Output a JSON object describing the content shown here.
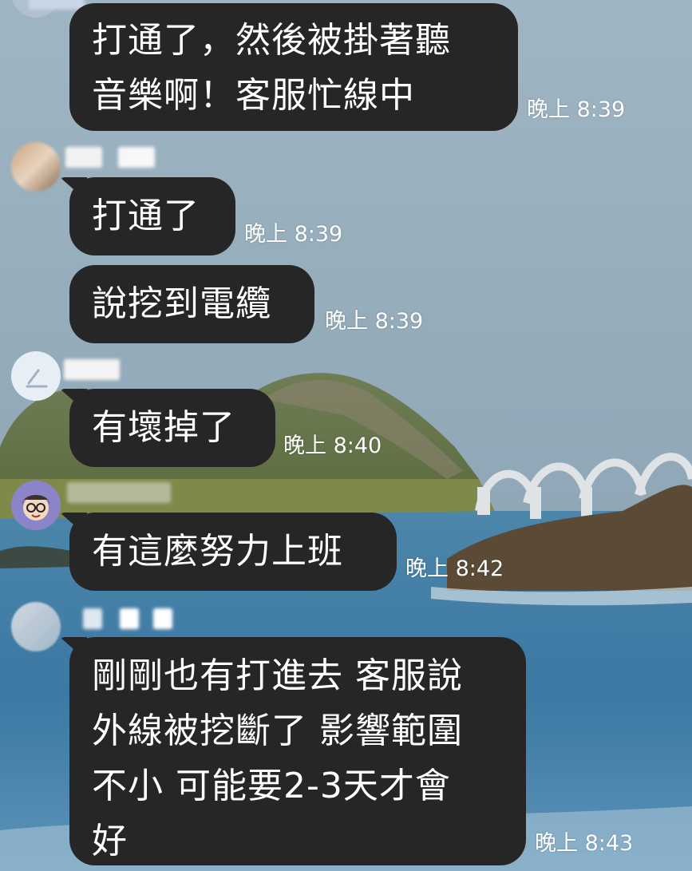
{
  "chat": {
    "messages": [
      {
        "text": "打通了，然後被掛著聽\n音樂啊！客服忙線中",
        "time": "晚上 8:39"
      },
      {
        "text": "打通了",
        "time": "晚上 8:39"
      },
      {
        "text": "說挖到電纜",
        "time": "晚上 8:39"
      },
      {
        "text": "有壞掉了",
        "time": "晚上 8:40"
      },
      {
        "text": "有這麼努力上班",
        "time": "晚上 8:42"
      },
      {
        "text": "剛剛也有打進去 客服說\n外線被挖斷了 影響範圍\n不小 可能要2-3天才會\n好",
        "time": "晚上 8:43"
      }
    ]
  },
  "colors": {
    "bubble": "#262626",
    "text": "#ffffff",
    "sky": "#8fa9b9",
    "sea": "#3c7ea8"
  },
  "icons": {
    "avatars": [
      "avatar-photo-icon",
      "avatar-light-icon",
      "avatar-cartoon-icon",
      "avatar-photo-icon"
    ]
  }
}
